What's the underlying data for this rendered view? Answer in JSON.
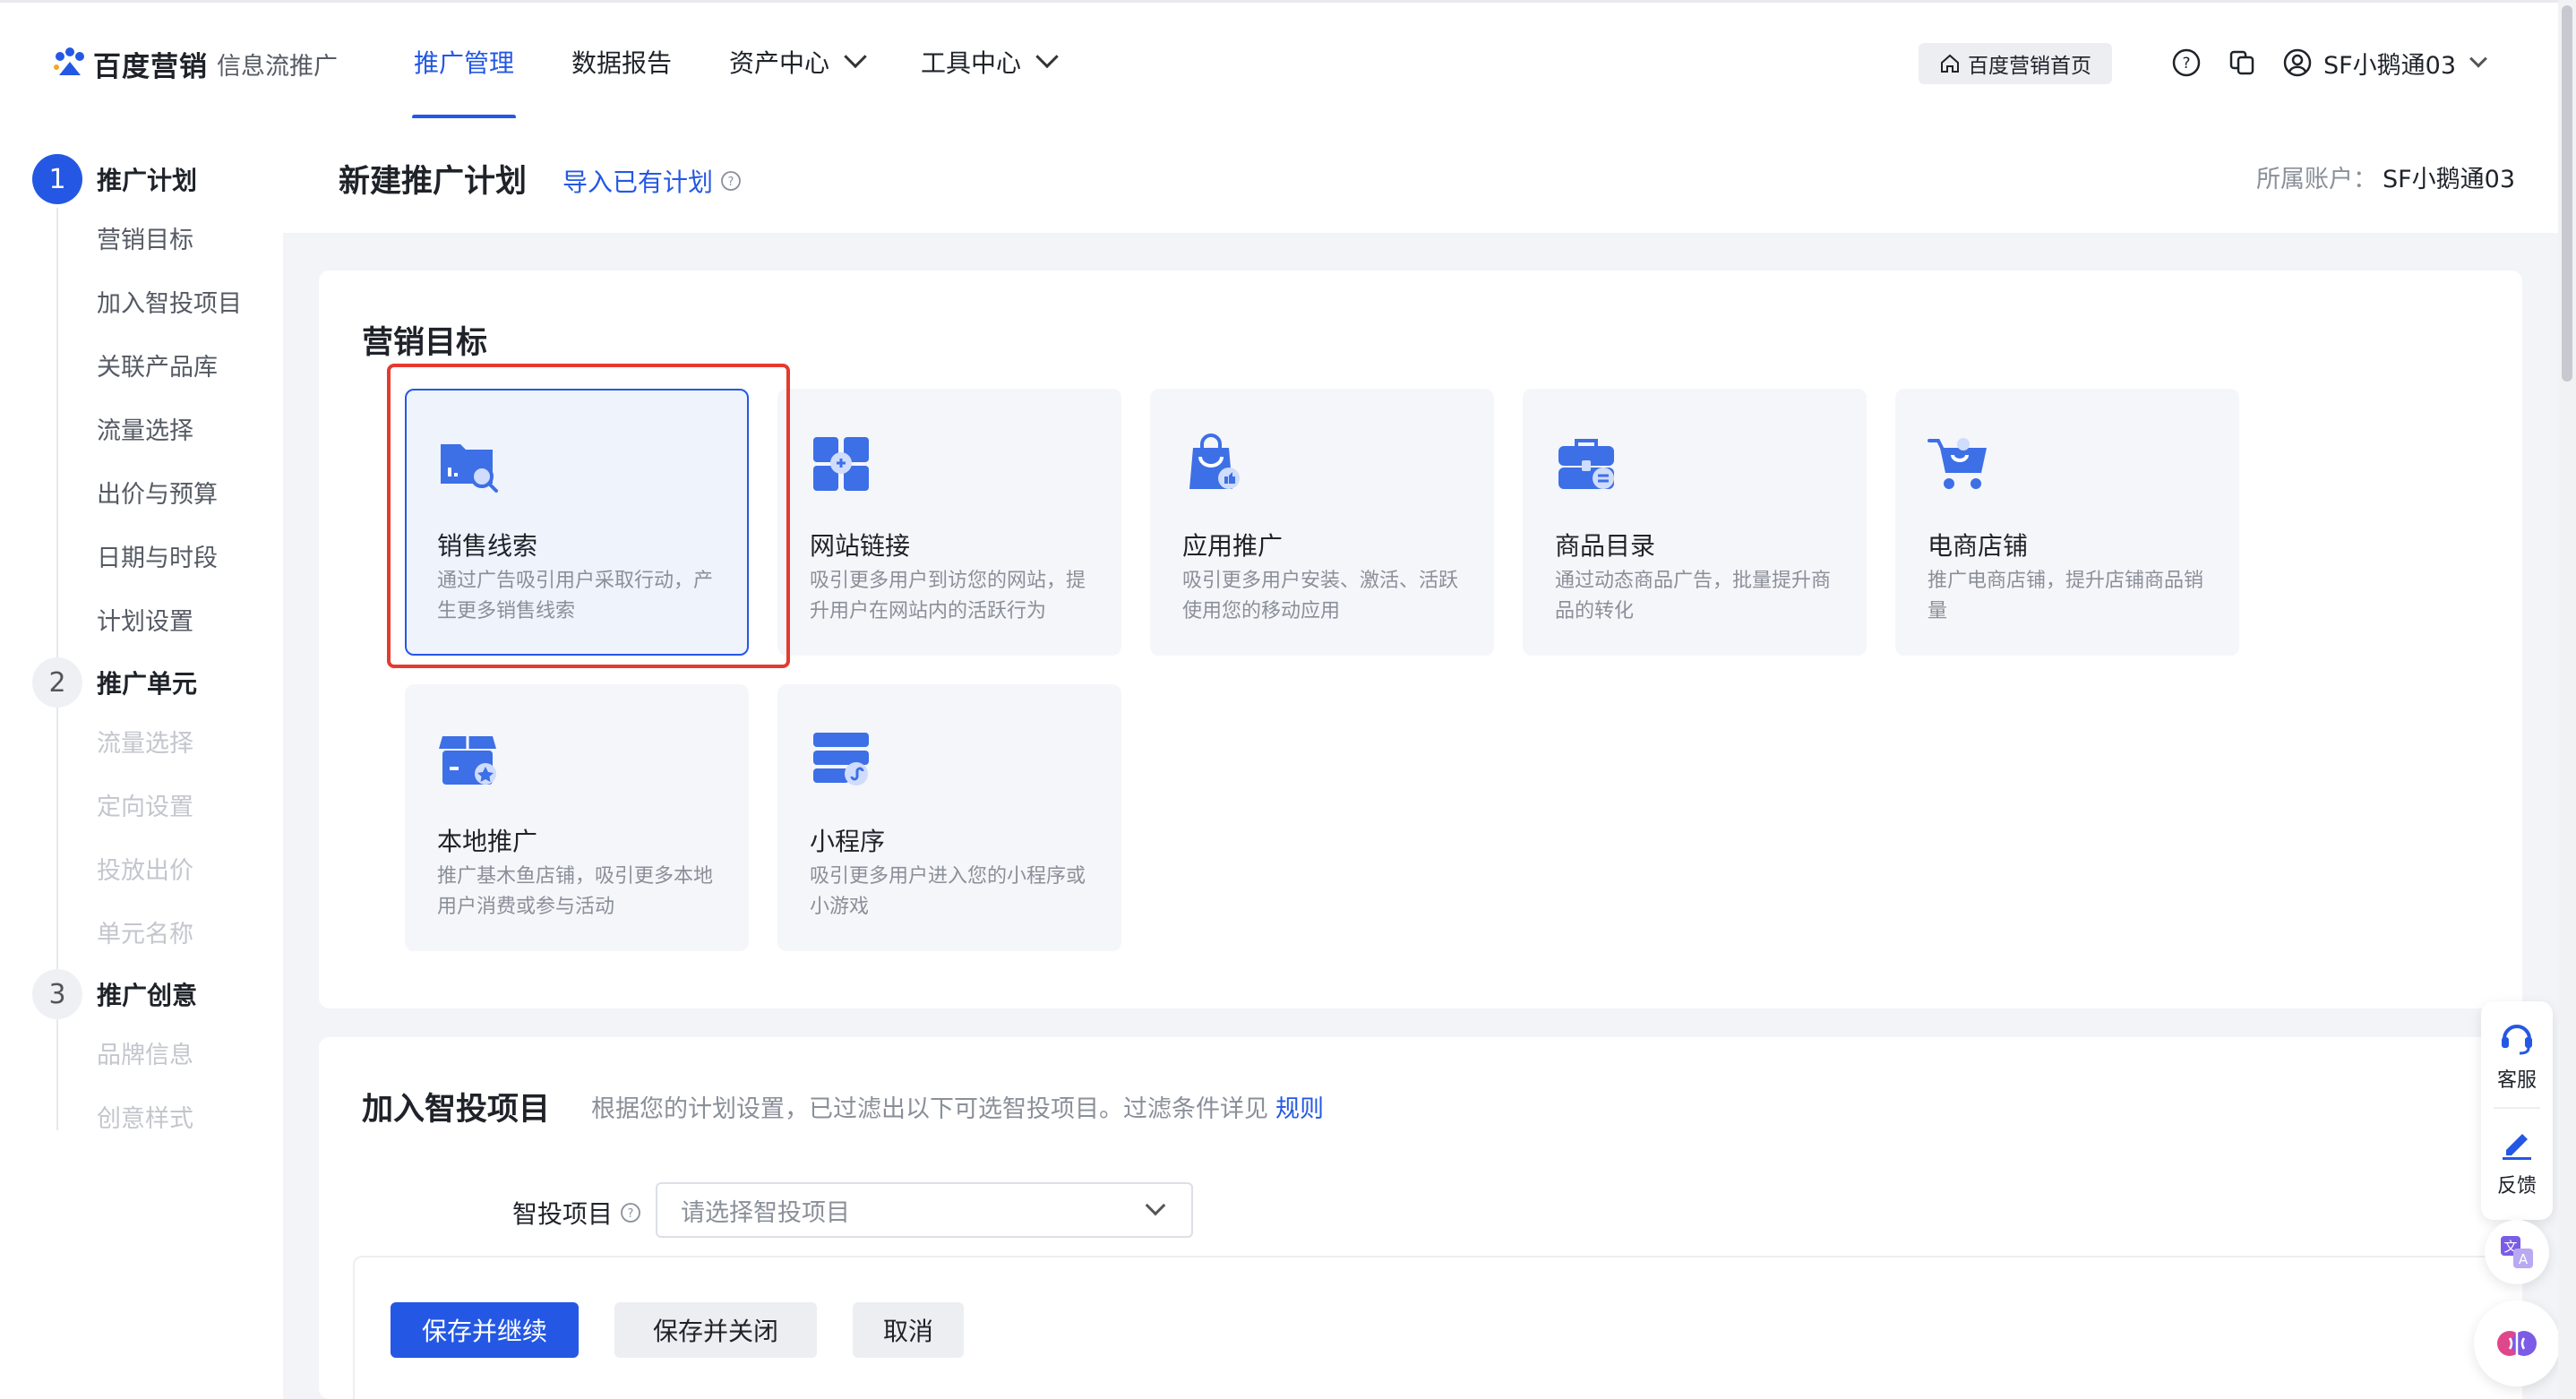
{
  "brand": {
    "name": "百度营销",
    "product": "信息流推广"
  },
  "nav": {
    "items": [
      {
        "label": "推广管理",
        "active": true
      },
      {
        "label": "数据报告"
      },
      {
        "label": "资产中心"
      },
      {
        "label": "工具中心"
      }
    ],
    "home_button": "百度营销首页",
    "user_name": "SF小鹅通03"
  },
  "steps": [
    {
      "num": "1",
      "title": "推广计划",
      "items": [
        "营销目标",
        "加入智投项目",
        "关联产品库",
        "流量选择",
        "出价与预算",
        "日期与时段",
        "计划设置"
      ]
    },
    {
      "num": "2",
      "title": "推广单元",
      "items": [
        "流量选择",
        "定向设置",
        "投放出价",
        "单元名称"
      ]
    },
    {
      "num": "3",
      "title": "推广创意",
      "items": [
        "品牌信息",
        "创意样式"
      ]
    }
  ],
  "header": {
    "title": "新建推广计划",
    "import_link": "导入已有计划",
    "account_label": "所属账户：",
    "account_name": "SF小鹅通03"
  },
  "marketing_goal": {
    "section_title": "营销目标",
    "selected": "销售线索",
    "options": [
      {
        "name": "销售线索",
        "desc": "通过广告吸引用户采取行动，产生更多销售线索",
        "icon": "folder-search-icon"
      },
      {
        "name": "网站链接",
        "desc": "吸引更多用户到访您的网站，提升用户在网站内的活跃行为",
        "icon": "website-link-icon"
      },
      {
        "name": "应用推广",
        "desc": "吸引更多用户安装、激活、活跃使用您的移动应用",
        "icon": "app-bag-icon"
      },
      {
        "name": "商品目录",
        "desc": "通过动态商品广告，批量提升商品的转化",
        "icon": "briefcase-icon"
      },
      {
        "name": "电商店铺",
        "desc": "推广电商店铺，提升店铺商品销量",
        "icon": "shopping-cart-icon"
      },
      {
        "name": "本地推广",
        "desc": "推广基木鱼店铺，吸引更多本地用户消费或参与活动",
        "icon": "local-store-icon"
      },
      {
        "name": "小程序",
        "desc": "吸引更多用户进入您的小程序或小游戏",
        "icon": "mini-program-icon"
      }
    ]
  },
  "smart_project": {
    "section_title": "加入智投项目",
    "note": "根据您的计划设置，已过滤出以下可选智投项目。过滤条件详见",
    "rule_link": "规则",
    "field_label": "智投项目",
    "placeholder": "请选择智投项目"
  },
  "actions": {
    "save_continue": "保存并继续",
    "save_close": "保存并关闭",
    "cancel": "取消"
  },
  "float_tools": {
    "service": "客服",
    "feedback": "反馈"
  },
  "colors": {
    "accent": "#2458e4",
    "highlight": "#e53a2f"
  }
}
